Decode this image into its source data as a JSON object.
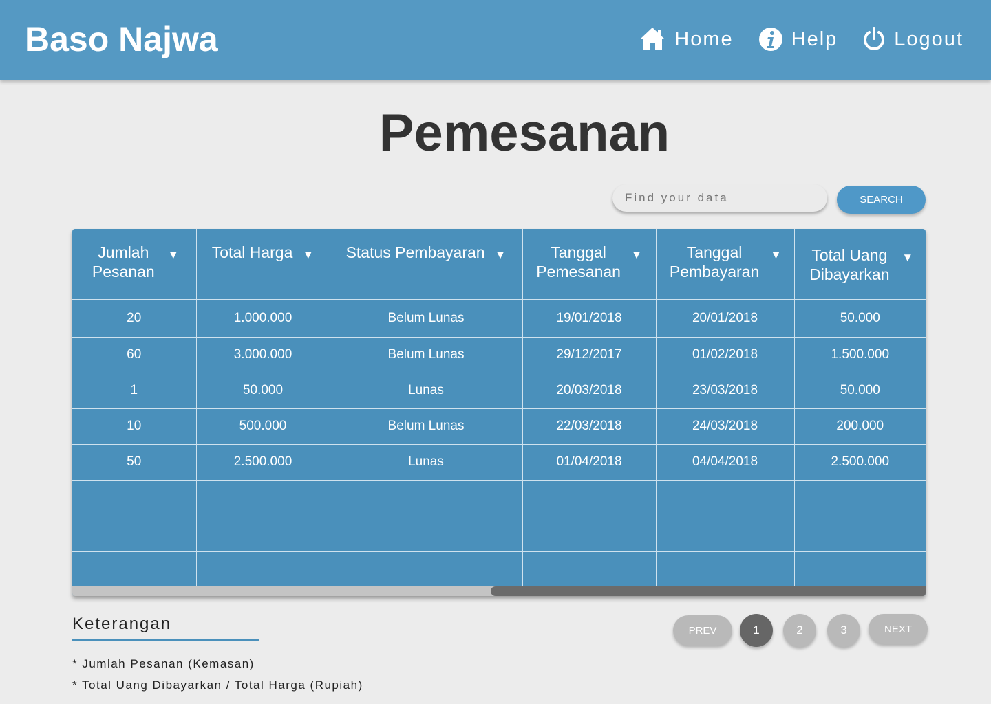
{
  "header": {
    "brand": "Baso Najwa",
    "nav": [
      {
        "label": "Home",
        "icon": "home-icon"
      },
      {
        "label": "Help",
        "icon": "info-icon"
      },
      {
        "label": "Logout",
        "icon": "power-icon"
      }
    ]
  },
  "page": {
    "title": "Pemesanan"
  },
  "search": {
    "placeholder": "Find your data",
    "button_label": "SEARCH"
  },
  "table": {
    "columns": [
      "Jumlah Pesanan",
      "Total Harga",
      "Status Pembayaran",
      "Tanggal Pemesanan",
      "Tanggal Pembayaran",
      "Total Uang Dibayarkan"
    ],
    "sort_icon": "caret-down-icon",
    "rows": [
      [
        "20",
        "1.000.000",
        "Belum Lunas",
        "19/01/2018",
        "20/01/2018",
        "50.000"
      ],
      [
        "60",
        "3.000.000",
        "Belum Lunas",
        "29/12/2017",
        "01/02/2018",
        "1.500.000"
      ],
      [
        "1",
        "50.000",
        "Lunas",
        "20/03/2018",
        "23/03/2018",
        "50.000"
      ],
      [
        "10",
        "500.000",
        "Belum Lunas",
        "22/03/2018",
        "24/03/2018",
        "200.000"
      ],
      [
        "50",
        "2.500.000",
        "Lunas",
        "01/04/2018",
        "04/04/2018",
        "2.500.000"
      ],
      [
        "",
        "",
        "",
        "",
        "",
        ""
      ],
      [
        "",
        "",
        "",
        "",
        "",
        ""
      ],
      [
        "",
        "",
        "",
        "",
        "",
        ""
      ]
    ]
  },
  "notes": {
    "title": "Keterangan",
    "lines": [
      "* Jumlah Pesanan (Kemasan)",
      "* Total Uang Dibayarkan / Total Harga (Rupiah)"
    ]
  },
  "pagination": {
    "prev": "PREV",
    "next": "NEXT",
    "pages": [
      "1",
      "2",
      "3"
    ],
    "current": "1"
  },
  "colors": {
    "header": "#5599c3",
    "table": "#4a90bb",
    "accent": "#4f98c8",
    "active_page": "#666666"
  }
}
